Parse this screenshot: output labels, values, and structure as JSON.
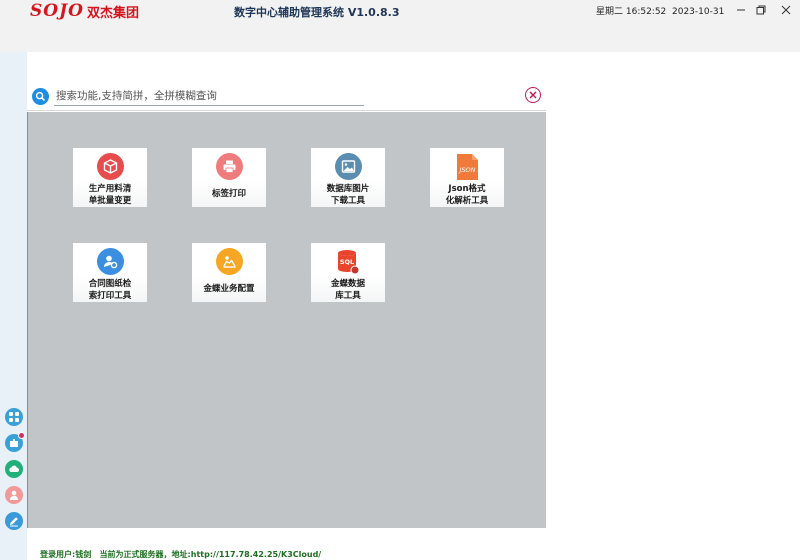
{
  "window": {
    "logo_en": "SOJO",
    "logo_cn": "双杰集团",
    "title": "数字中心辅助管理系统  V1.0.8.3",
    "datetime": "星期二 16:52:52  2023-10-31",
    "controls": [
      "minimize-icon",
      "maximize-icon",
      "close-icon"
    ]
  },
  "search": {
    "placeholder": "搜索功能,支持简拼，全拼模糊查询",
    "value": ""
  },
  "tiles": [
    {
      "label": "生产用料清\n单批量变更",
      "icon": "box-icon",
      "color": "#e84b4b"
    },
    {
      "label": "标签打印",
      "icon": "printer-icon",
      "color": "#ef7c7c"
    },
    {
      "label": "数据库图片\n下载工具",
      "icon": "image-icon",
      "color": "#5a8db0"
    },
    {
      "label": "Json格式\n化解析工具",
      "icon": "json-file-icon",
      "color": "#f07a3a"
    },
    {
      "label": "合同图纸检\n索打印工具",
      "icon": "user-search-icon",
      "color": "#3b8fe0"
    },
    {
      "label": "金蝶业务配置",
      "icon": "config-icon",
      "color": "#f5a623"
    },
    {
      "label": "金蝶数据\n库工具",
      "icon": "sql-database-icon",
      "color": "#e8452c"
    }
  ],
  "left_tools": [
    {
      "icon": "apps-grid-icon",
      "color": "#3aa0d8"
    },
    {
      "icon": "puzzle-icon",
      "color": "#3aa0d8",
      "notification": true
    },
    {
      "icon": "cloud-icon",
      "color": "#22b07a"
    },
    {
      "icon": "person-icon",
      "color": "#f29a9a"
    },
    {
      "icon": "edit-icon",
      "color": "#3a9ad9"
    }
  ],
  "status": {
    "text": "登录用户:钱剑   当前为正式服务器，地址:http://117.78.42.25/K3Cloud/"
  }
}
